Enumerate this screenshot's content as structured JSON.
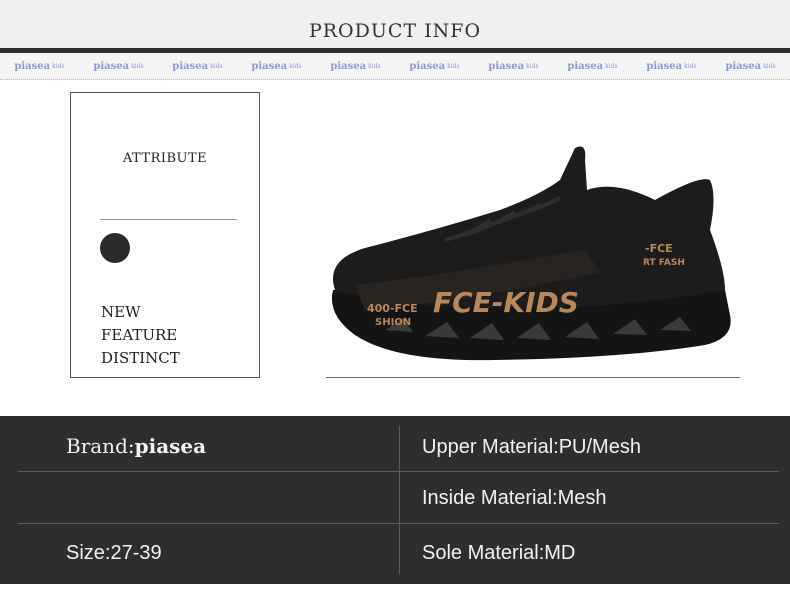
{
  "header": {
    "title": "PRODUCT  INFO"
  },
  "logo_strip": {
    "items": [
      {
        "brand": "piasea",
        "sub": "kids"
      },
      {
        "brand": "piasea",
        "sub": "kids"
      },
      {
        "brand": "piasea",
        "sub": "kids"
      },
      {
        "brand": "piasea",
        "sub": "kids"
      },
      {
        "brand": "piasea",
        "sub": "kids"
      },
      {
        "brand": "piasea",
        "sub": "kids"
      },
      {
        "brand": "piasea",
        "sub": "kids"
      },
      {
        "brand": "piasea",
        "sub": "kids"
      },
      {
        "brand": "piasea",
        "sub": "kids"
      },
      {
        "brand": "piasea",
        "sub": "kids"
      }
    ]
  },
  "attribute": {
    "title": "ATTRIBUTE",
    "lines": [
      "NEW",
      "FEATURE",
      "DISTINCT"
    ]
  },
  "product_image": {
    "print_left": "400-FCE",
    "print_left_sub": "SHION",
    "print_main": "FCE-KIDS",
    "print_heel": "-FCE",
    "print_heel_sub": "RT FASH"
  },
  "specs": {
    "brand_label": "Brand:",
    "brand_name": "piasea",
    "upper_material": "Upper Material:PU/Mesh",
    "inside_material": "Inside Material:Mesh",
    "size": "Size:27-39",
    "sole_material": "Sole Material:MD"
  },
  "colors": {
    "panel": "#2e2e2e",
    "header_bg": "#f0f0f0",
    "strip_text": "#8a9ad6",
    "shoe_print": "#b8875a"
  }
}
